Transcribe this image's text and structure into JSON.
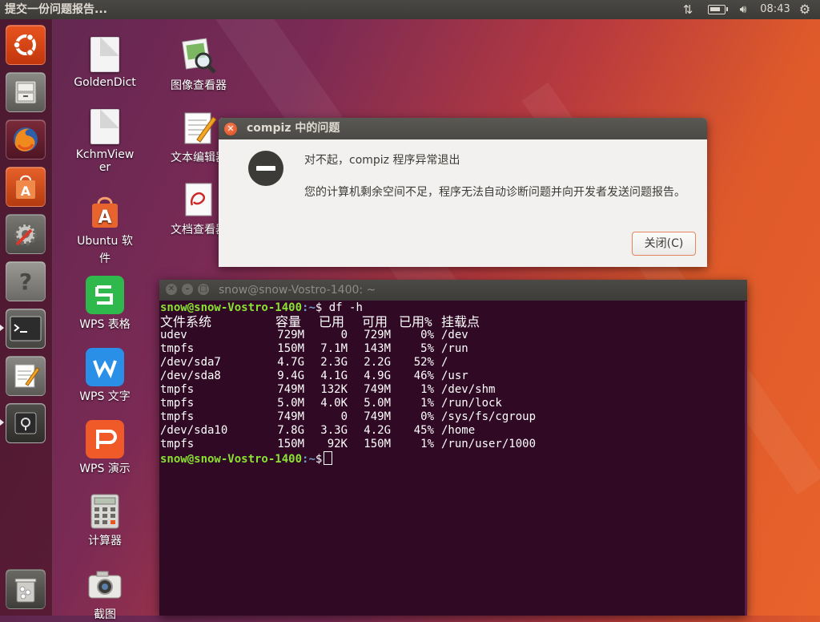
{
  "top_panel": {
    "app_title": "提交一份问题报告...",
    "clock": "08:43",
    "icons": [
      "network-updown-icon",
      "battery-icon",
      "volume-icon",
      "session-gear-icon"
    ]
  },
  "launcher": {
    "items": [
      {
        "name": "ubuntu-dash",
        "icon": "ubuntu-logo-icon"
      },
      {
        "name": "files",
        "icon": "file-cabinet-icon"
      },
      {
        "name": "firefox",
        "icon": "firefox-icon"
      },
      {
        "name": "ubuntu-software",
        "icon": "shopping-bag-icon"
      },
      {
        "name": "system-settings",
        "icon": "settings-gear-icon"
      },
      {
        "name": "help",
        "icon": "question-icon"
      },
      {
        "name": "terminal",
        "icon": "terminal-icon"
      },
      {
        "name": "text-editor",
        "icon": "text-editor-icon"
      },
      {
        "name": "usb-drive",
        "icon": "removable-drive-icon"
      },
      {
        "name": "trash",
        "icon": "trash-icon"
      }
    ]
  },
  "desktop": {
    "icons": [
      {
        "label": "GoldenDict"
      },
      {
        "label1": "KchmView",
        "label2": "er"
      },
      {
        "label1": "Ubuntu 软",
        "label2": "件"
      },
      {
        "label": "WPS 表格"
      },
      {
        "label": "WPS 文字"
      },
      {
        "label": "WPS 演示"
      },
      {
        "label": "计算器"
      },
      {
        "label": "截图"
      },
      {
        "label": "图像查看器"
      },
      {
        "label": "文本编辑器"
      },
      {
        "label": "文档查看器"
      }
    ]
  },
  "dialog": {
    "title": "compiz 中的问题",
    "heading": "对不起，compiz 程序异常退出",
    "message": "您的计算机剩余空间不足，程序无法自动诊断问题并向开发者发送问题报告。",
    "close_button": "关闭(C)",
    "accent": "#dd4814"
  },
  "terminal": {
    "title": "snow@snow-Vostro-1400: ~",
    "prompt_user": "snow@snow-Vostro-1400",
    "prompt_path": ":~",
    "prompt_symbol": "$",
    "command": " df -h",
    "headers": [
      "文件系统",
      "容量",
      "已用",
      "可用",
      "已用%",
      "挂载点"
    ],
    "rows": [
      [
        "udev",
        "729M",
        "0",
        "729M",
        "0%",
        "/dev"
      ],
      [
        "tmpfs",
        "150M",
        "7.1M",
        "143M",
        "5%",
        "/run"
      ],
      [
        "/dev/sda7",
        "4.7G",
        "2.3G",
        "2.2G",
        "52%",
        "/"
      ],
      [
        "/dev/sda8",
        "9.4G",
        "4.1G",
        "4.9G",
        "46%",
        "/usr"
      ],
      [
        "tmpfs",
        "749M",
        "132K",
        "749M",
        "1%",
        "/dev/shm"
      ],
      [
        "tmpfs",
        "5.0M",
        "4.0K",
        "5.0M",
        "1%",
        "/run/lock"
      ],
      [
        "tmpfs",
        "749M",
        "0",
        "749M",
        "0%",
        "/sys/fs/cgroup"
      ],
      [
        "/dev/sda10",
        "7.8G",
        "3.3G",
        "4.2G",
        "45%",
        "/home"
      ],
      [
        "tmpfs",
        "150M",
        "92K",
        "150M",
        "1%",
        "/run/user/1000"
      ]
    ],
    "colors": {
      "background": "#300a24",
      "prompt_user": "#8ae234",
      "prompt_path": "#729fcf"
    }
  }
}
